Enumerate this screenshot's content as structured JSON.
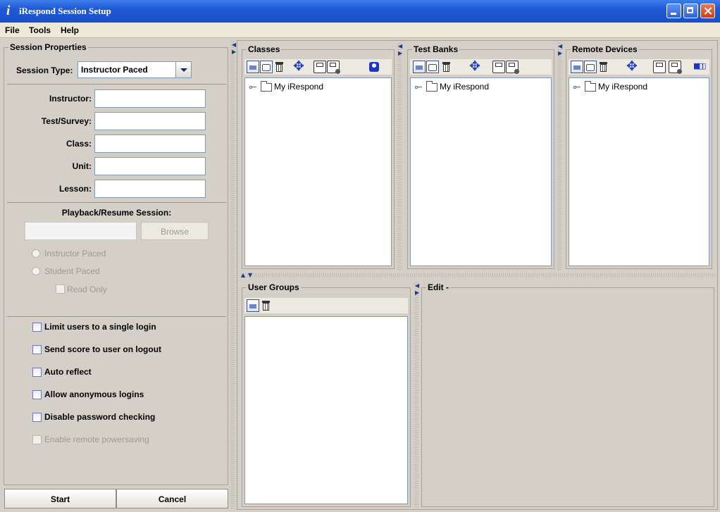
{
  "window": {
    "title": "iRespond Session Setup",
    "app_icon": "i",
    "controls": [
      "minimize-icon",
      "maximize-icon",
      "close-icon"
    ]
  },
  "menubar": {
    "items": [
      "File",
      "Tools",
      "Help"
    ]
  },
  "session_properties": {
    "legend": "Session Properties",
    "session_type_label": "Session Type:",
    "session_type_value": "Instructor Paced",
    "fields": [
      {
        "label": "Instructor:",
        "value": ""
      },
      {
        "label": "Test/Survey:",
        "value": ""
      },
      {
        "label": "Class:",
        "value": ""
      },
      {
        "label": "Unit:",
        "value": ""
      },
      {
        "label": "Lesson:",
        "value": ""
      }
    ],
    "playback": {
      "title": "Playback/Resume Session:",
      "path_value": "",
      "browse_label": "Browse",
      "radios": [
        "Instructor Paced",
        "Student Paced"
      ],
      "read_only_label": "Read Only"
    },
    "options": [
      {
        "label": "Limit users to a single login",
        "enabled": true
      },
      {
        "label": "Send score to user on logout",
        "enabled": true
      },
      {
        "label": "Auto reflect",
        "enabled": true
      },
      {
        "label": "Allow anonymous logins",
        "enabled": true
      },
      {
        "label": "Disable password checking",
        "enabled": true
      },
      {
        "label": "Enable remote powersaving",
        "enabled": false
      }
    ],
    "start_label": "Start",
    "cancel_label": "Cancel"
  },
  "panels": {
    "classes": {
      "legend": "Classes",
      "tree_root": "My iRespond"
    },
    "test_banks": {
      "legend": "Test Banks",
      "tree_root": "My iRespond"
    },
    "remote_devices": {
      "legend": "Remote Devices",
      "tree_root": "My iRespond"
    },
    "user_groups": {
      "legend": "User Groups"
    },
    "edit": {
      "legend": "Edit -"
    }
  },
  "colors": {
    "titlebar": "#1f58d6",
    "window_bg": "#d4d0c8",
    "field_border": "#7f9db9",
    "toolbar_icon_blue": "#1f3fbf"
  }
}
